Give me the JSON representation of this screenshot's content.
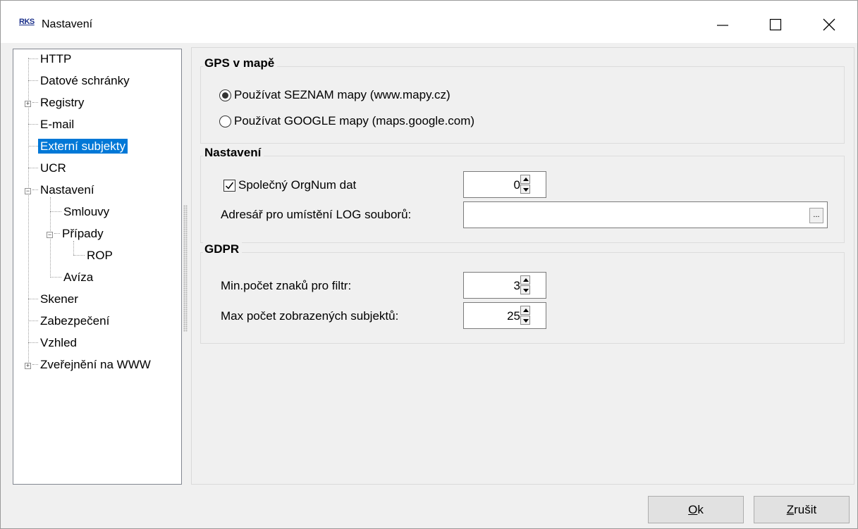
{
  "window": {
    "icon_text": "RKS",
    "title": "Nastavení"
  },
  "tree": {
    "items": [
      {
        "label": "HTTP"
      },
      {
        "label": "Datové schránky"
      },
      {
        "label": "Registry"
      },
      {
        "label": "E-mail"
      },
      {
        "label": "Externí subjekty"
      },
      {
        "label": "UCR"
      },
      {
        "label": "Nastavení"
      },
      {
        "label": "Smlouvy"
      },
      {
        "label": "Případy"
      },
      {
        "label": "ROP"
      },
      {
        "label": "Avíza"
      },
      {
        "label": "Skener"
      },
      {
        "label": "Zabezpečení"
      },
      {
        "label": "Vzhled"
      },
      {
        "label": "Zveřejnění na WWW"
      }
    ],
    "selected": "Externí subjekty"
  },
  "gps": {
    "title": "GPS v mapě",
    "option_seznam": "Používat SEZNAM mapy (www.mapy.cz)",
    "option_google": "Používat GOOGLE mapy (maps.google.com)",
    "selected": "seznam"
  },
  "nastaveni": {
    "title": "Nastavení",
    "orgnum_label": "Společný OrgNum dat",
    "orgnum_checked": true,
    "orgnum_value": "0",
    "log_dir_label": "Adresář pro umístění LOG souborů:",
    "log_dir_value": "",
    "browse_label": "..."
  },
  "gdpr": {
    "title": "GDPR",
    "min_chars_label": "Min.počet znaků pro filtr:",
    "min_chars_value": "3",
    "max_subjects_label": "Max počet zobrazených subjektů:",
    "max_subjects_value": "25"
  },
  "buttons": {
    "ok_mnemonic": "O",
    "ok_rest": "k",
    "cancel_mnemonic": "Z",
    "cancel_rest": "rušit"
  }
}
